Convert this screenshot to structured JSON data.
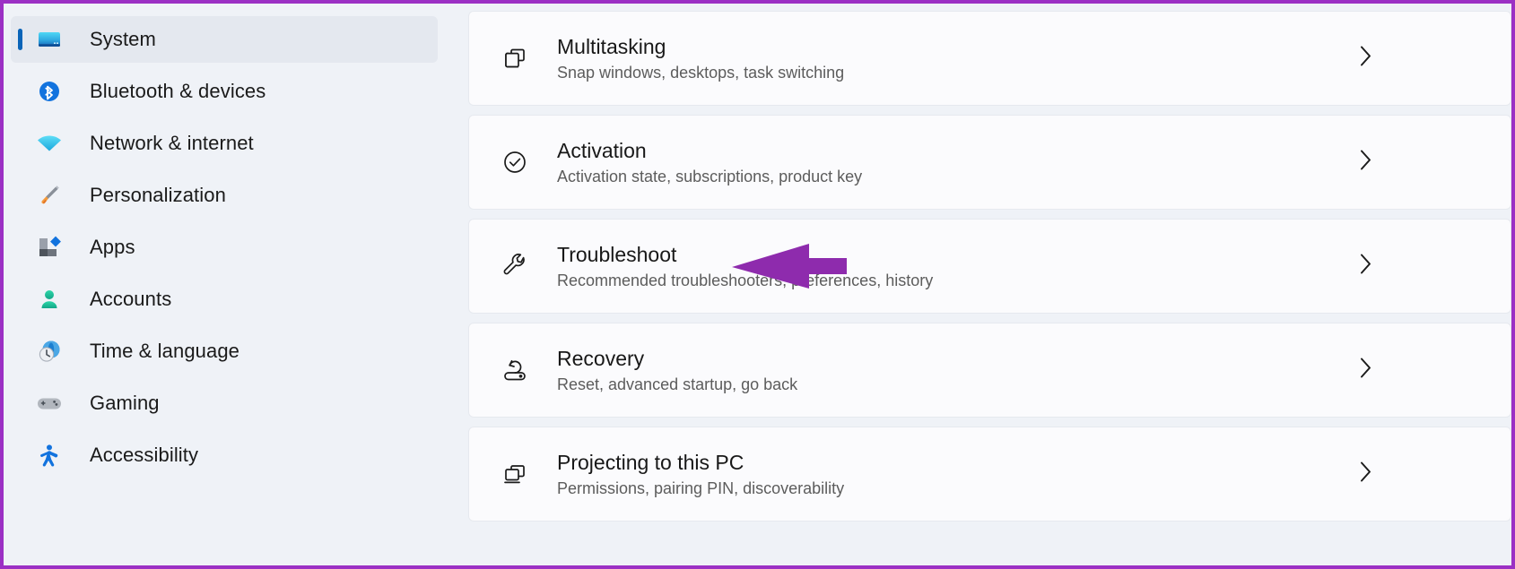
{
  "annotation": {
    "arrow_color": "#8E2BAD",
    "arrow_name": "troubleshoot-callout-arrow",
    "points_to": "Troubleshoot"
  },
  "frame": {
    "border_color": "#9B30C4",
    "background": "#EFF2F7"
  },
  "sidebar": {
    "accent_color": "#0A64B8",
    "selected_background": "#E4E8EF",
    "items": [
      {
        "label": "System",
        "icon": "monitor-icon",
        "selected": true
      },
      {
        "label": "Bluetooth & devices",
        "icon": "bluetooth-icon",
        "selected": false
      },
      {
        "label": "Network & internet",
        "icon": "wifi-icon",
        "selected": false
      },
      {
        "label": "Personalization",
        "icon": "paintbrush-icon",
        "selected": false
      },
      {
        "label": "Apps",
        "icon": "apps-icon",
        "selected": false
      },
      {
        "label": "Accounts",
        "icon": "person-icon",
        "selected": false
      },
      {
        "label": "Time & language",
        "icon": "clock-globe-icon",
        "selected": false
      },
      {
        "label": "Gaming",
        "icon": "gamepad-icon",
        "selected": false
      },
      {
        "label": "Accessibility",
        "icon": "accessibility-icon",
        "selected": false
      }
    ]
  },
  "main": {
    "card_background": "#FBFBFD",
    "card_border": "#E6E9EF",
    "chevron_glyph": "›",
    "cards": [
      {
        "title": "Multitasking",
        "subtitle": "Snap windows, desktops, task switching",
        "icon": "multitasking-icon"
      },
      {
        "title": "Activation",
        "subtitle": "Activation state, subscriptions, product key",
        "icon": "check-circle-icon"
      },
      {
        "title": "Troubleshoot",
        "subtitle": "Recommended troubleshooters, preferences, history",
        "icon": "wrench-icon"
      },
      {
        "title": "Recovery",
        "subtitle": "Reset, advanced startup, go back",
        "icon": "recovery-disk-icon"
      },
      {
        "title": "Projecting to this PC",
        "subtitle": "Permissions, pairing PIN, discoverability",
        "icon": "projecting-icon"
      }
    ]
  }
}
